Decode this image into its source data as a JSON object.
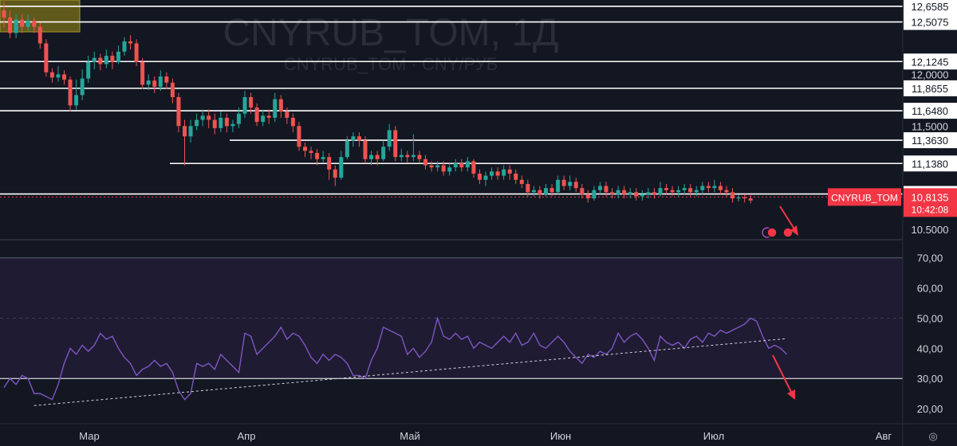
{
  "watermark": {
    "title": "CNYRUB_TOM, 1Д",
    "subtitle": "CNYRUB_TOM · CNY/РУБ"
  },
  "colors": {
    "background": "#131722",
    "up": "#26a69a",
    "down": "#ef5350",
    "levels": "#ffffff",
    "rsi": "#7e57c2",
    "rsi_band": "#1f1b33",
    "zone": "#8a7d1a",
    "price_tag": "#f23645"
  },
  "chart_data": {
    "type": "candlestick",
    "title": "CNYRUB_TOM, 1Д",
    "x_labels": [
      "Мар",
      "Апр",
      "Май",
      "Июн",
      "Июл",
      "Авг"
    ],
    "price_axis": {
      "ylim": [
        10.4,
        12.72
      ],
      "ticks": [
        "12,0000",
        "11,5000",
        "10.5000"
      ]
    },
    "levels": [
      "12,6585",
      "12,5075",
      "12,1245",
      "11,8655",
      "11,6480",
      "11,3630",
      "11,1380",
      "10,8430"
    ],
    "last_price": {
      "symbol": "CNYRUB_TOM",
      "price": "10,8135",
      "time": "10:42:08"
    },
    "candles": [
      [
        12.62,
        12.55,
        12.7,
        12.45
      ],
      [
        12.55,
        12.4,
        12.62,
        12.35
      ],
      [
        12.4,
        12.53,
        12.58,
        12.35
      ],
      [
        12.53,
        12.46,
        12.58,
        12.4
      ],
      [
        12.46,
        12.52,
        12.58,
        12.42
      ],
      [
        12.52,
        12.46,
        12.55,
        12.4
      ],
      [
        12.46,
        12.3,
        12.5,
        12.25
      ],
      [
        12.3,
        12.02,
        12.34,
        11.98
      ],
      [
        12.02,
        11.97,
        12.06,
        11.92
      ],
      [
        11.97,
        12.0,
        12.08,
        11.93
      ],
      [
        12.0,
        11.95,
        12.04,
        11.9
      ],
      [
        11.95,
        11.7,
        11.98,
        11.64
      ],
      [
        11.7,
        11.8,
        11.95,
        11.66
      ],
      [
        11.8,
        11.96,
        12.05,
        11.75
      ],
      [
        11.96,
        12.12,
        12.18,
        11.92
      ],
      [
        12.12,
        12.16,
        12.22,
        12.05
      ],
      [
        12.16,
        12.1,
        12.2,
        12.04
      ],
      [
        12.1,
        12.18,
        12.24,
        12.06
      ],
      [
        12.18,
        12.12,
        12.22,
        12.05
      ],
      [
        12.12,
        12.22,
        12.28,
        12.1
      ],
      [
        12.22,
        12.32,
        12.36,
        12.18
      ],
      [
        12.32,
        12.3,
        12.38,
        12.24
      ],
      [
        12.3,
        12.12,
        12.34,
        12.08
      ],
      [
        12.12,
        11.9,
        12.16,
        11.86
      ],
      [
        11.9,
        11.94,
        12.0,
        11.85
      ],
      [
        11.94,
        11.88,
        11.98,
        11.82
      ],
      [
        11.88,
        11.98,
        12.04,
        11.84
      ],
      [
        11.98,
        11.92,
        12.02,
        11.86
      ],
      [
        11.92,
        11.78,
        11.96,
        11.72
      ],
      [
        11.78,
        11.5,
        11.82,
        11.44
      ],
      [
        11.5,
        11.4,
        11.56,
        11.12
      ],
      [
        11.4,
        11.5,
        11.56,
        11.34
      ],
      [
        11.5,
        11.56,
        11.62,
        11.46
      ],
      [
        11.56,
        11.6,
        11.66,
        11.5
      ],
      [
        11.6,
        11.56,
        11.66,
        11.48
      ],
      [
        11.56,
        11.48,
        11.62,
        11.42
      ],
      [
        11.48,
        11.58,
        11.64,
        11.44
      ],
      [
        11.58,
        11.5,
        11.62,
        11.44
      ],
      [
        11.5,
        11.52,
        11.56,
        11.44
      ],
      [
        11.52,
        11.62,
        11.68,
        11.48
      ],
      [
        11.62,
        11.78,
        11.84,
        11.58
      ],
      [
        11.78,
        11.68,
        11.82,
        11.62
      ],
      [
        11.68,
        11.54,
        11.72,
        11.5
      ],
      [
        11.54,
        11.6,
        11.66,
        11.5
      ],
      [
        11.6,
        11.58,
        11.66,
        11.52
      ],
      [
        11.58,
        11.76,
        11.82,
        11.54
      ],
      [
        11.76,
        11.64,
        11.8,
        11.58
      ],
      [
        11.64,
        11.58,
        11.68,
        11.52
      ],
      [
        11.58,
        11.5,
        11.62,
        11.44
      ],
      [
        11.5,
        11.3,
        11.54,
        11.26
      ],
      [
        11.3,
        11.26,
        11.34,
        11.2
      ],
      [
        11.26,
        11.24,
        11.3,
        11.18
      ],
      [
        11.24,
        11.18,
        11.28,
        11.12
      ],
      [
        11.18,
        11.2,
        11.26,
        11.14
      ],
      [
        11.2,
        11.08,
        11.24,
        10.98
      ],
      [
        11.08,
        11.0,
        11.12,
        10.92
      ],
      [
        11.0,
        11.2,
        11.26,
        10.98
      ],
      [
        11.2,
        11.36,
        11.4,
        11.18
      ],
      [
        11.36,
        11.4,
        11.44,
        11.3
      ],
      [
        11.4,
        11.36,
        11.44,
        11.3
      ],
      [
        11.36,
        11.18,
        11.4,
        11.14
      ],
      [
        11.18,
        11.22,
        11.26,
        11.12
      ],
      [
        11.22,
        11.18,
        11.26,
        11.12
      ],
      [
        11.18,
        11.3,
        11.36,
        11.16
      ],
      [
        11.3,
        11.46,
        11.52,
        11.26
      ],
      [
        11.46,
        11.2,
        11.5,
        11.16
      ],
      [
        11.2,
        11.22,
        11.28,
        11.16
      ],
      [
        11.22,
        11.2,
        11.26,
        11.14
      ],
      [
        11.2,
        11.22,
        11.42,
        11.16
      ],
      [
        11.22,
        11.18,
        11.26,
        11.14
      ],
      [
        11.18,
        11.12,
        11.22,
        11.08
      ],
      [
        11.12,
        11.1,
        11.16,
        11.06
      ],
      [
        11.1,
        11.12,
        11.16,
        11.06
      ],
      [
        11.12,
        11.06,
        11.16,
        11.02
      ],
      [
        11.06,
        11.1,
        11.14,
        11.02
      ],
      [
        11.1,
        11.14,
        11.18,
        11.06
      ],
      [
        11.14,
        11.1,
        11.18,
        11.06
      ],
      [
        11.1,
        11.16,
        11.2,
        11.06
      ],
      [
        11.16,
        11.04,
        11.18,
        11.0
      ],
      [
        11.04,
        10.98,
        11.08,
        10.94
      ],
      [
        10.98,
        11.02,
        11.06,
        10.92
      ],
      [
        11.02,
        11.06,
        11.1,
        10.98
      ],
      [
        11.06,
        11.02,
        11.1,
        10.98
      ],
      [
        11.02,
        11.08,
        11.12,
        10.98
      ],
      [
        11.08,
        11.04,
        11.12,
        10.98
      ],
      [
        11.04,
        10.98,
        11.08,
        10.94
      ],
      [
        10.98,
        10.94,
        11.02,
        10.9
      ],
      [
        10.94,
        10.86,
        10.98,
        10.82
      ],
      [
        10.86,
        10.88,
        10.92,
        10.82
      ],
      [
        10.88,
        10.84,
        10.92,
        10.8
      ],
      [
        10.84,
        10.9,
        10.94,
        10.82
      ],
      [
        10.9,
        10.86,
        10.94,
        10.82
      ],
      [
        10.86,
        10.98,
        11.02,
        10.84
      ],
      [
        10.98,
        10.92,
        11.02,
        10.88
      ],
      [
        10.92,
        10.96,
        11.02,
        10.88
      ],
      [
        10.96,
        10.9,
        11.0,
        10.86
      ],
      [
        10.9,
        10.84,
        10.94,
        10.8
      ],
      [
        10.84,
        10.8,
        10.88,
        10.76
      ],
      [
        10.8,
        10.88,
        10.92,
        10.78
      ],
      [
        10.88,
        10.92,
        10.96,
        10.84
      ],
      [
        10.92,
        10.86,
        10.96,
        10.82
      ],
      [
        10.86,
        10.84,
        10.9,
        10.8
      ],
      [
        10.84,
        10.88,
        10.92,
        10.8
      ],
      [
        10.88,
        10.84,
        10.92,
        10.8
      ],
      [
        10.84,
        10.86,
        10.9,
        10.8
      ],
      [
        10.86,
        10.82,
        10.9,
        10.78
      ],
      [
        10.82,
        10.84,
        10.88,
        10.78
      ],
      [
        10.84,
        10.86,
        10.9,
        10.8
      ],
      [
        10.86,
        10.84,
        10.9,
        10.8
      ],
      [
        10.84,
        10.9,
        10.96,
        10.82
      ],
      [
        10.9,
        10.88,
        10.94,
        10.84
      ],
      [
        10.88,
        10.86,
        10.92,
        10.82
      ],
      [
        10.86,
        10.88,
        10.92,
        10.82
      ],
      [
        10.88,
        10.9,
        10.94,
        10.84
      ],
      [
        10.9,
        10.86,
        10.94,
        10.82
      ],
      [
        10.86,
        10.88,
        10.92,
        10.82
      ],
      [
        10.88,
        10.92,
        10.96,
        10.84
      ],
      [
        10.92,
        10.9,
        10.96,
        10.86
      ],
      [
        10.9,
        10.92,
        10.98,
        10.86
      ],
      [
        10.92,
        10.88,
        10.96,
        10.84
      ],
      [
        10.88,
        10.86,
        10.92,
        10.82
      ],
      [
        10.86,
        10.8,
        10.9,
        10.76
      ],
      [
        10.8,
        10.81,
        10.84,
        10.77
      ],
      [
        10.81,
        10.8,
        10.84,
        10.76
      ],
      [
        10.8,
        10.78,
        10.83,
        10.75
      ]
    ],
    "rsi": {
      "ylim": [
        15,
        76
      ],
      "ticks": [
        "70,00",
        "60,00",
        "50,00",
        "40,00",
        "30,00",
        "20,00"
      ],
      "band": [
        30,
        70
      ],
      "midline": 50,
      "values": [
        27,
        30,
        28,
        31,
        30,
        25,
        25,
        24,
        23,
        28,
        35,
        40,
        38,
        41,
        39,
        41,
        45,
        43,
        44,
        40,
        37,
        35,
        31,
        33,
        34,
        36,
        34,
        35,
        32,
        26,
        23,
        25,
        35,
        34,
        35,
        33,
        38,
        36,
        34,
        32,
        45,
        44,
        38,
        40,
        42,
        44,
        47,
        43,
        45,
        44,
        41,
        37,
        35,
        38,
        36,
        38,
        37,
        35,
        31,
        31,
        30,
        36,
        40,
        47,
        46,
        45,
        44,
        38,
        40,
        37,
        39,
        42,
        50,
        44,
        43,
        45,
        43,
        44,
        40,
        42,
        41,
        40,
        42,
        44,
        42,
        45,
        41,
        42,
        45,
        41,
        40,
        42,
        44,
        42,
        39,
        37,
        35,
        38,
        37,
        39,
        38,
        40,
        45,
        42,
        44,
        45,
        43,
        40,
        36,
        44,
        42,
        41,
        42,
        40,
        43,
        44,
        42,
        45,
        44,
        46,
        45,
        46,
        47,
        48,
        50,
        49,
        44,
        40,
        41,
        40,
        38
      ],
      "trendline": [
        [
          5,
          21
        ],
        [
          130,
          43.2
        ]
      ]
    }
  },
  "annotations": {
    "arrows": [
      "down-arrow",
      "down-arrow"
    ]
  }
}
